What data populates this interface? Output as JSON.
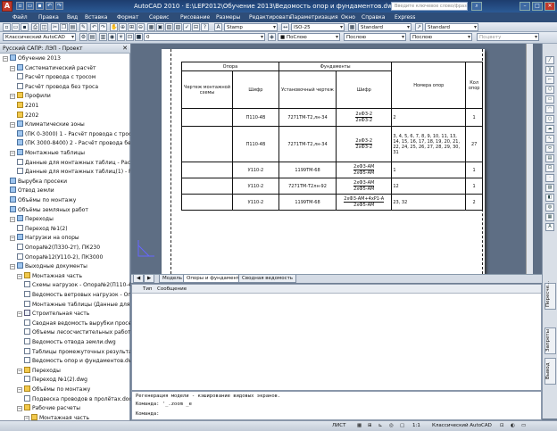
{
  "window": {
    "title": "AutoCAD 2010 · E:\\LEP2012\\Обучение 2013\\Ведомость опор и фундаментов.dwg",
    "search_placeholder": "Введите ключевое слово/фразу"
  },
  "menu": [
    "Файл",
    "Правка",
    "Вид",
    "Вставка",
    "Формат",
    "Сервис",
    "Рисование",
    "Размеры",
    "Редактировать",
    "Параметризация",
    "Окно",
    "Справка",
    "Express"
  ],
  "toolbar1": {
    "style_combo": "Stamp",
    "dim_combo": "ISO-25",
    "text_combo": "Standard",
    "table_combo": "Standard"
  },
  "toolbar2": {
    "workspace": "Классический AutoCAD",
    "layer": "0",
    "color": "■ ПоСлою",
    "linetype": "Послою",
    "lineweight": "Послою",
    "plot": "Поцвету"
  },
  "left_panel": {
    "title": "Русский САПР: ЛЭП - Проект",
    "close": "✕",
    "tree": [
      {
        "label": "Обучение 2013",
        "icon": "calc",
        "level": 0,
        "tog": "−"
      },
      {
        "label": "Систематический расчёт",
        "icon": "calc",
        "level": 1,
        "tog": "−"
      },
      {
        "label": "Расчёт провода с тросом",
        "icon": "doc",
        "level": 2
      },
      {
        "label": "Расчёт провода без троса",
        "icon": "doc",
        "level": 2
      },
      {
        "label": "Профили",
        "icon": "folder",
        "level": 1,
        "tog": "−"
      },
      {
        "label": "2201",
        "icon": "folder",
        "level": 2
      },
      {
        "label": "2202",
        "icon": "folder",
        "level": 2
      },
      {
        "label": "Климатические зоны",
        "icon": "calc",
        "level": 1,
        "tog": "−"
      },
      {
        "label": "(ПК 0-3000) 1 - Расчёт провода с тросо",
        "icon": "calc",
        "level": 2
      },
      {
        "label": "(ПК 3000-8400) 2 - Расчёт провода бе",
        "icon": "calc",
        "level": 2
      },
      {
        "label": "Монтажные таблицы",
        "icon": "calc",
        "level": 1,
        "tog": "−"
      },
      {
        "label": "Данные для монтажных таблиц - Расч",
        "icon": "doc",
        "level": 2
      },
      {
        "label": "Данные для монтажных таблиц(1) - Ра",
        "icon": "doc",
        "level": 2
      },
      {
        "label": "Вырубка просеки",
        "icon": "calc",
        "level": 1
      },
      {
        "label": "Отвод земли",
        "icon": "calc",
        "level": 1
      },
      {
        "label": "Объёмы по монтажу",
        "icon": "calc",
        "level": 1
      },
      {
        "label": "Объёмы земляных работ",
        "icon": "calc",
        "level": 1
      },
      {
        "label": "Переходы",
        "icon": "calc",
        "level": 1,
        "tog": "−"
      },
      {
        "label": "Переход №1(2)",
        "icon": "doc",
        "level": 2
      },
      {
        "label": "Нагрузки на опоры",
        "icon": "calc",
        "level": 1,
        "tog": "−"
      },
      {
        "label": "Опора№2(П330-2т), ПК230",
        "icon": "doc",
        "level": 2
      },
      {
        "label": "Опора№12(У110-2), ПК3000",
        "icon": "doc",
        "level": 2
      },
      {
        "label": "Выходные документы",
        "icon": "calc",
        "level": 1,
        "tog": "−"
      },
      {
        "label": "Монтажная часть",
        "icon": "folder",
        "level": 2,
        "tog": "−"
      },
      {
        "label": "Схемы нагрузок - Опора№2(П110-4",
        "icon": "doc",
        "level": 3
      },
      {
        "label": "Ведомость ветровых нагрузок - Опо",
        "icon": "doc",
        "level": 3
      },
      {
        "label": "Монтажные таблицы (Данные для м",
        "icon": "doc",
        "level": 3
      },
      {
        "label": "Строительная часть",
        "icon": "sel",
        "level": 2,
        "tog": "−"
      },
      {
        "label": "Сводная ведомость вырубки просек",
        "icon": "doc",
        "level": 3
      },
      {
        "label": "Объемы лесосчистительных работ-",
        "icon": "doc",
        "level": 3
      },
      {
        "label": "Ведомость отвода земли.dwg",
        "icon": "doc",
        "level": 3
      },
      {
        "label": "Таблицы промежуточных результат",
        "icon": "doc",
        "level": 3
      },
      {
        "label": "Ведомость опор и фундаментов.dw",
        "icon": "doc",
        "level": 3
      },
      {
        "label": "Переходы",
        "icon": "folder",
        "level": 2,
        "tog": "−"
      },
      {
        "label": "Переход №1(2).dwg",
        "icon": "doc",
        "level": 3
      },
      {
        "label": "Объёмы по монтажу",
        "icon": "folder",
        "level": 2,
        "tog": "−"
      },
      {
        "label": "Подвеска проводов в пролётах.doc",
        "icon": "doc",
        "level": 3
      },
      {
        "label": "Рабочие расчеты",
        "icon": "folder",
        "level": 2,
        "tog": "−"
      },
      {
        "label": "Монтажная часть",
        "icon": "folder",
        "level": 3,
        "tog": "−"
      },
      {
        "label": "",
        "icon": "doc",
        "level": 4
      }
    ]
  },
  "drawing_table": {
    "header_opora": "Опора",
    "header_fund": "Фундаменты",
    "col_scheme": "Чертеж монтажной схемы",
    "col_shifr1": "Шифр",
    "col_ustan": "Установочный чертеж",
    "col_shifr2": "Шифр",
    "col_nomera": "Номера опор",
    "col_kol": "Кол опор",
    "rows": [
      {
        "shifr": "П110-4В",
        "ustan": "7271ТМ-Т2,лн-34",
        "f_top": "2хФ3-2",
        "f_bot": "2хФ3-2",
        "nomera": "2",
        "kol": "1"
      },
      {
        "shifr": "П110-4В",
        "ustan": "7271ТМ-Т2,лн-34",
        "f_top": "2хФ3-2",
        "f_bot": "2хФ3-2",
        "nomera": "3, 4, 5, 6, 7, 8, 9, 10, 11, 13, 14, 15, 16, 17, 18, 19, 20, 21, 22, 24, 25, 26, 27, 28, 29, 30, 31",
        "kol": "27"
      },
      {
        "shifr": "У110-2",
        "ustan": "1199ТМ-68",
        "f_top": "2хФ3-АМ",
        "f_bot": "2хФ5-АМ",
        "nomera": "1",
        "kol": "1"
      },
      {
        "shifr": "У110-2",
        "ustan": "7271ТМ-Т2лн-92",
        "f_top": "2хФ3-АМ",
        "f_bot": "2хФ5-АМ",
        "nomera": "12",
        "kol": "1"
      },
      {
        "shifr": "У110-2",
        "ustan": "1199ТМ-68",
        "f_top": "2хФ3-АМ+4хР1-А",
        "f_bot": "2хФ5-АМ",
        "nomera": "23, 32",
        "kol": "2"
      }
    ]
  },
  "layout_tabs": [
    "Модель",
    "Опоры и фундаменты",
    "Сводная ведомость"
  ],
  "output": {
    "col_type": "Тип",
    "col_msg": "Сообщение"
  },
  "right_tabs": [
    "Пересче...",
    "Запреты",
    "Вывод"
  ],
  "command": {
    "line1": "Регенерация модели - кэширование видовых экранов.",
    "line2": "Команда: '_.zoom _e",
    "line3": "Команда:"
  },
  "status": {
    "sheet": "ЛИСТ",
    "scale": "1:1",
    "workspace": "Классический AutoCAD"
  }
}
